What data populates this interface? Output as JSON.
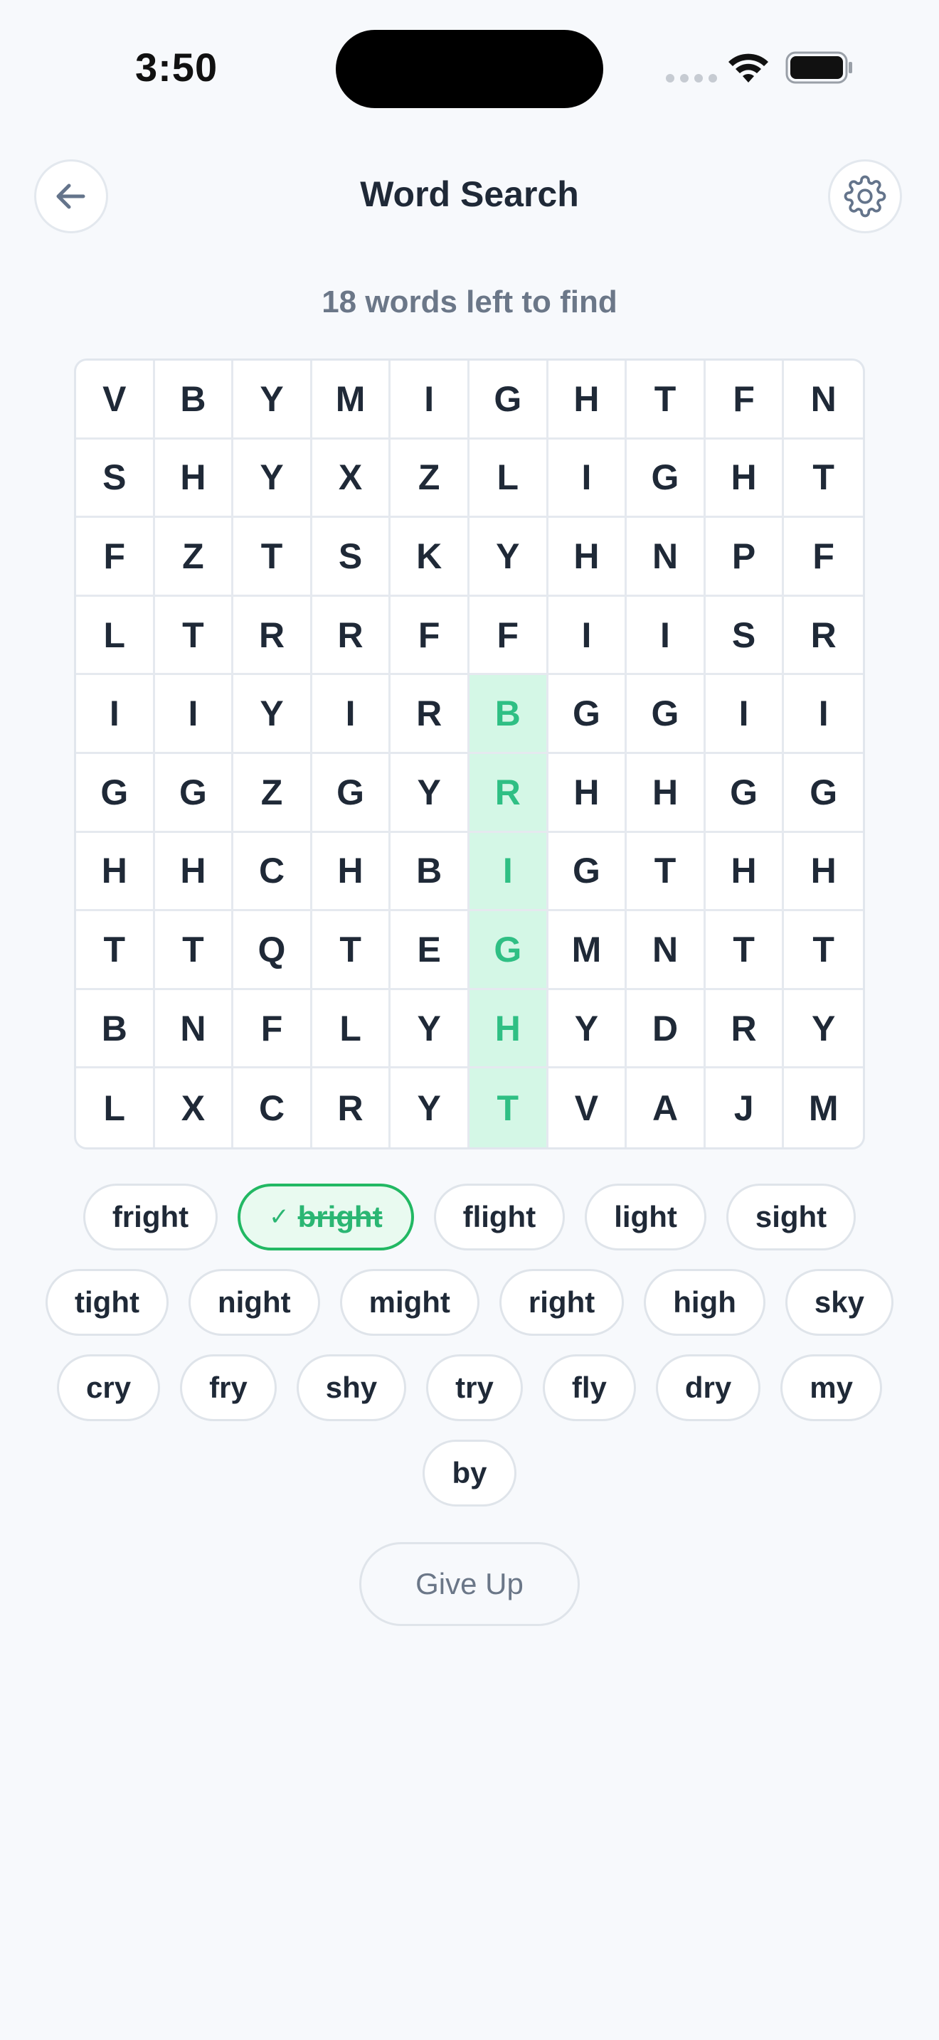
{
  "status_bar": {
    "time": "3:50"
  },
  "header": {
    "title": "Word Search",
    "back_icon": "arrow-left-icon",
    "settings_icon": "gear-icon"
  },
  "progress": {
    "words_left_text": "18 words left to find"
  },
  "grid": {
    "rows": [
      [
        "V",
        "B",
        "Y",
        "M",
        "I",
        "G",
        "H",
        "T",
        "F",
        "N"
      ],
      [
        "S",
        "H",
        "Y",
        "X",
        "Z",
        "L",
        "I",
        "G",
        "H",
        "T"
      ],
      [
        "F",
        "Z",
        "T",
        "S",
        "K",
        "Y",
        "H",
        "N",
        "P",
        "F"
      ],
      [
        "L",
        "T",
        "R",
        "R",
        "F",
        "F",
        "I",
        "I",
        "S",
        "R"
      ],
      [
        "I",
        "I",
        "Y",
        "I",
        "R",
        "B",
        "G",
        "G",
        "I",
        "I"
      ],
      [
        "G",
        "G",
        "Z",
        "G",
        "Y",
        "R",
        "H",
        "H",
        "G",
        "G"
      ],
      [
        "H",
        "H",
        "C",
        "H",
        "B",
        "I",
        "G",
        "T",
        "H",
        "H"
      ],
      [
        "T",
        "T",
        "Q",
        "T",
        "E",
        "G",
        "M",
        "N",
        "T",
        "T"
      ],
      [
        "B",
        "N",
        "F",
        "L",
        "Y",
        "H",
        "Y",
        "D",
        "R",
        "Y"
      ],
      [
        "L",
        "X",
        "C",
        "R",
        "Y",
        "T",
        "V",
        "A",
        "J",
        "M"
      ]
    ],
    "found_cells": [
      [
        4,
        5
      ],
      [
        5,
        5
      ],
      [
        6,
        5
      ],
      [
        7,
        5
      ],
      [
        8,
        5
      ],
      [
        9,
        5
      ]
    ],
    "found_color": "#2fbf84",
    "found_bg": "#d4f7e6"
  },
  "word_bank": {
    "rows": [
      [
        {
          "word": "fright",
          "found": false
        },
        {
          "word": "bright",
          "found": true
        },
        {
          "word": "flight",
          "found": false
        },
        {
          "word": "light",
          "found": false
        },
        {
          "word": "sight",
          "found": false
        }
      ],
      [
        {
          "word": "tight",
          "found": false
        },
        {
          "word": "night",
          "found": false
        },
        {
          "word": "might",
          "found": false
        },
        {
          "word": "right",
          "found": false
        },
        {
          "word": "high",
          "found": false
        },
        {
          "word": "sky",
          "found": false
        }
      ],
      [
        {
          "word": "cry",
          "found": false
        },
        {
          "word": "fry",
          "found": false
        },
        {
          "word": "shy",
          "found": false
        },
        {
          "word": "try",
          "found": false
        },
        {
          "word": "fly",
          "found": false
        },
        {
          "word": "dry",
          "found": false
        },
        {
          "word": "my",
          "found": false
        }
      ],
      [
        {
          "word": "by",
          "found": false
        }
      ]
    ],
    "found_check": "✓"
  },
  "actions": {
    "give_up_label": "Give Up"
  }
}
